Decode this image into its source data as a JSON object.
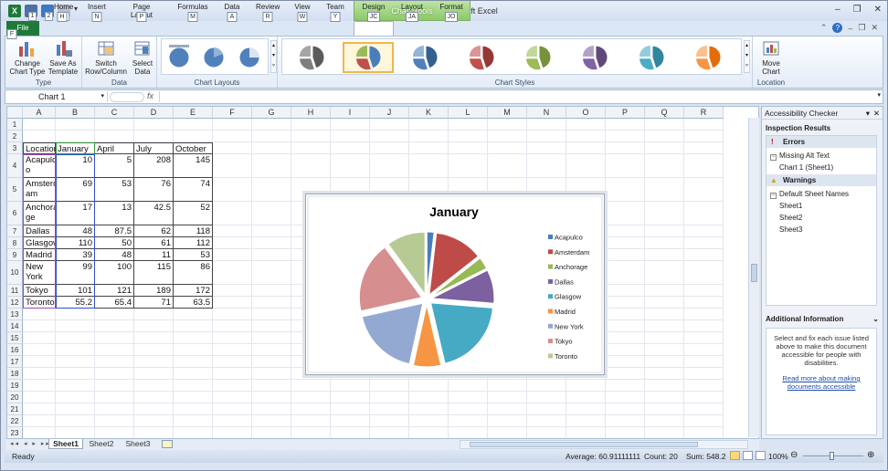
{
  "app": {
    "title": "precipitation  -  Microsoft Excel",
    "context_tab_group": "Chart Tools"
  },
  "qat": {
    "keytips": [
      "1",
      "2",
      "3"
    ]
  },
  "tabs": [
    {
      "label": "File",
      "keytip": "F"
    },
    {
      "label": "Home",
      "keytip": "H"
    },
    {
      "label": "Insert",
      "keytip": "N"
    },
    {
      "label": "Page Layout",
      "keytip": "P"
    },
    {
      "label": "Formulas",
      "keytip": "M"
    },
    {
      "label": "Data",
      "keytip": "A"
    },
    {
      "label": "Review",
      "keytip": "R"
    },
    {
      "label": "View",
      "keytip": "W"
    },
    {
      "label": "Team",
      "keytip": "Y"
    },
    {
      "label": "Design",
      "keytip": "JC"
    },
    {
      "label": "Layout",
      "keytip": "JA"
    },
    {
      "label": "Format",
      "keytip": "JO"
    }
  ],
  "ribbon": {
    "type_group": {
      "label": "Type",
      "buttons": [
        "Change\nChart Type",
        "Save As\nTemplate"
      ]
    },
    "data_group": {
      "label": "Data",
      "buttons": [
        "Switch\nRow/Column",
        "Select\nData"
      ]
    },
    "layouts_group": {
      "label": "Chart Layouts"
    },
    "styles_group": {
      "label": "Chart Styles",
      "styles": [
        {
          "colors": [
            "#5b5b5b",
            "#7f7f7f",
            "#a5a5a5"
          ]
        },
        {
          "colors": [
            "#4a7ebb",
            "#c0504d",
            "#9bbb59"
          ],
          "selected": true
        },
        {
          "colors": [
            "#365f91",
            "#4f81bd",
            "#95b3d7"
          ]
        },
        {
          "colors": [
            "#953735",
            "#c0504d",
            "#d99694"
          ]
        },
        {
          "colors": [
            "#76923c",
            "#9bbb59",
            "#c3d69b"
          ]
        },
        {
          "colors": [
            "#5f497a",
            "#8064a2",
            "#b3a2c7"
          ]
        },
        {
          "colors": [
            "#31859c",
            "#4bacc6",
            "#93cddd"
          ]
        },
        {
          "colors": [
            "#e46c0a",
            "#f79646",
            "#fac08f"
          ]
        }
      ]
    },
    "location_group": {
      "label": "Location",
      "buttons": [
        "Move\nChart"
      ]
    }
  },
  "formula_bar": {
    "name_box": "Chart 1",
    "fx": "fx"
  },
  "columns": [
    "A",
    "B",
    "C",
    "D",
    "E",
    "F",
    "G",
    "H",
    "I",
    "J",
    "K",
    "L",
    "M",
    "N",
    "O",
    "P",
    "Q",
    "R"
  ],
  "table": {
    "headers": [
      "Location",
      "January",
      "April",
      "July",
      "October"
    ],
    "rows": [
      {
        "row": "4",
        "cells": [
          "Acapulc\no",
          "10",
          "5",
          "208",
          "145"
        ]
      },
      {
        "row": "5",
        "cells": [
          "Amsterd\nam",
          "69",
          "53",
          "76",
          "74"
        ]
      },
      {
        "row": "6",
        "cells": [
          "Anchora\nge",
          "17",
          "13",
          "42.5",
          "52"
        ]
      },
      {
        "row": "7",
        "cells": [
          "Dallas",
          "48",
          "87.5",
          "62",
          "118"
        ]
      },
      {
        "row": "8",
        "cells": [
          "Glasgow",
          "110",
          "50",
          "61",
          "112"
        ]
      },
      {
        "row": "9",
        "cells": [
          "Madrid",
          "39",
          "48",
          "11",
          "53"
        ]
      },
      {
        "row": "10",
        "cells": [
          "New\nYork",
          "99",
          "100",
          "115",
          "86"
        ]
      },
      {
        "row": "11",
        "cells": [
          "Tokyo",
          "101",
          "121",
          "189",
          "172"
        ]
      },
      {
        "row": "12",
        "cells": [
          "Toronto",
          "55.2",
          "65.4",
          "71",
          "63.5"
        ]
      }
    ]
  },
  "chart_data": {
    "type": "pie",
    "title": "January",
    "categories": [
      "Acapulco",
      "Amsterdam",
      "Anchorage",
      "Dallas",
      "Glasgow",
      "Madrid",
      "New York",
      "Tokyo",
      "Toronto"
    ],
    "values": [
      10,
      69,
      17,
      48,
      110,
      39,
      99,
      101,
      55.2
    ],
    "colors": [
      "#4a7ebb",
      "#be4b48",
      "#98b954",
      "#7d60a0",
      "#46aac5",
      "#f69544",
      "#94a9d1",
      "#d68f8e",
      "#b7ca93"
    ],
    "legend": "right",
    "exploded": true
  },
  "pane": {
    "title": "Accessibility Checker",
    "inspection_title": "Inspection Results",
    "errors_label": "Errors",
    "error_items": [
      "Missing Alt Text",
      "Chart 1 (Sheet1)"
    ],
    "warnings_label": "Warnings",
    "warning_items": [
      "Default Sheet Names",
      "Sheet1",
      "Sheet2",
      "Sheet3"
    ],
    "additional_title": "Additional Information",
    "info_text": "Select and fix each issue listed above to make this document accessible for people with disabilities.",
    "info_link": "Read more about making documents accessible"
  },
  "sheets": [
    "Sheet1",
    "Sheet2",
    "Sheet3"
  ],
  "status": {
    "ready": "Ready",
    "average": "Average: 60.91111111",
    "count": "Count: 20",
    "sum": "Sum: 548.2",
    "zoom": "100%"
  }
}
